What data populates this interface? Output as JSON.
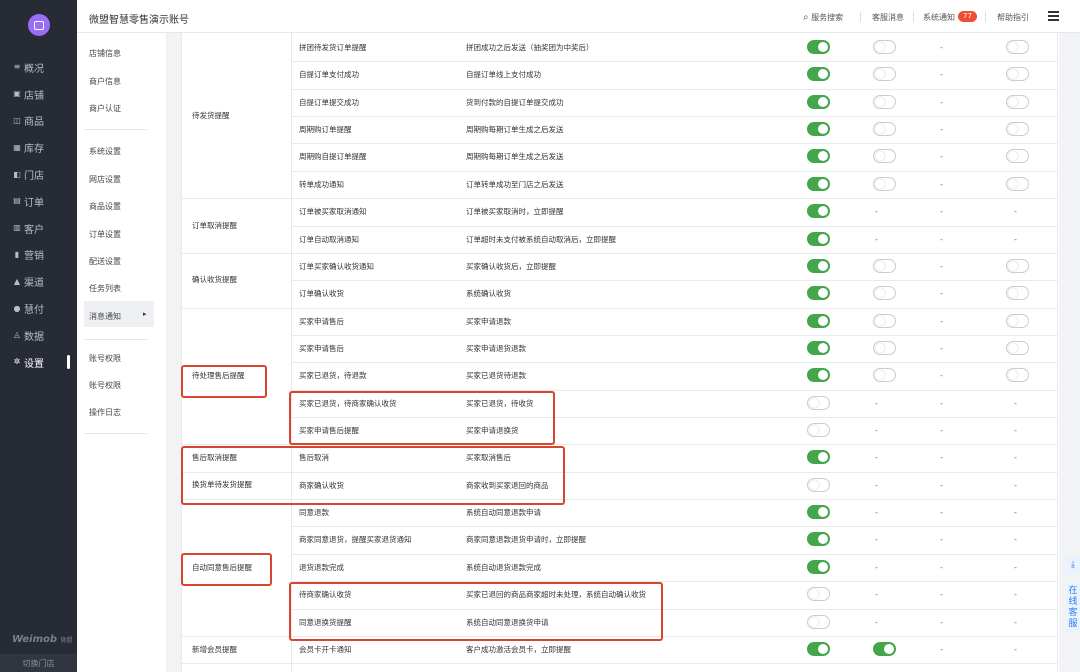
{
  "app": {
    "title": "微盟智慧零售演示账号",
    "brand": "Weimob",
    "brand_sub": "微盟",
    "switch_store": "切换门店",
    "accent": "#43a64a",
    "highlight": "#d9442c"
  },
  "header": {
    "search": "服务搜索",
    "service": "客服消息",
    "notify": "系统通知",
    "notify_count": "77",
    "help": "帮助指引"
  },
  "nav": [
    {
      "icon": "list-icon",
      "label": "概况"
    },
    {
      "icon": "store-icon",
      "label": "店铺"
    },
    {
      "icon": "bag-icon",
      "label": "商品"
    },
    {
      "icon": "grid-icon",
      "label": "库存"
    },
    {
      "icon": "door-icon",
      "label": "门店"
    },
    {
      "icon": "order-icon",
      "label": "订单"
    },
    {
      "icon": "user-icon",
      "label": "客户"
    },
    {
      "icon": "chart-icon",
      "label": "营销"
    },
    {
      "icon": "warning-icon",
      "label": "渠道"
    },
    {
      "icon": "pay-icon",
      "label": "慧付"
    },
    {
      "icon": "data-icon",
      "label": "数据"
    },
    {
      "icon": "gear-icon",
      "label": "设置"
    }
  ],
  "subnav": {
    "g1": [
      "店铺信息",
      "商户信息",
      "商户认证"
    ],
    "g2_title": "系统设置",
    "g2": [
      "网店设置",
      "商品设置",
      "订单设置",
      "配送设置",
      "任务列表",
      "消息通知"
    ],
    "g3_title": "账号权限",
    "g3": [
      "账号权限",
      "操作日志"
    ]
  },
  "groups": [
    "待发货提醒",
    "订单取消提醒",
    "确认收货提醒",
    "待处理售后提醒",
    "售后取消提醒",
    "换货单待发货提醒",
    "自动同意售后提醒",
    "新增会员提醒"
  ],
  "rows": [
    {
      "name": "拼团待发货订单提醒",
      "desc": "拼团成功之后发送（抽奖团为中奖后）",
      "c1": "on",
      "c2": "off",
      "c3": "-",
      "c4": "off"
    },
    {
      "name": "自提订单支付成功",
      "desc": "自提订单线上支付成功",
      "c1": "on",
      "c2": "off",
      "c3": "-",
      "c4": "off"
    },
    {
      "name": "自提订单提交成功",
      "desc": "货到付款的自提订单提交成功",
      "c1": "on",
      "c2": "off",
      "c3": "-",
      "c4": "off"
    },
    {
      "name": "周期购订单提醒",
      "desc": "周期购每期订单生成之后发送",
      "c1": "on",
      "c2": "off",
      "c3": "-",
      "c4": "off"
    },
    {
      "name": "周期购自提订单提醒",
      "desc": "周期购每期订单生成之后发送",
      "c1": "on",
      "c2": "off",
      "c3": "-",
      "c4": "off"
    },
    {
      "name": "转单成功通知",
      "desc": "订单转单成功至门店之后发送",
      "c1": "on",
      "c2": "off",
      "c3": "-",
      "c4": "off"
    },
    {
      "name": "订单被买家取消通知",
      "desc": "订单被买家取消时，立即提醒",
      "c1": "on",
      "c2": "-",
      "c3": "-",
      "c4": "-"
    },
    {
      "name": "订单自动取消通知",
      "desc": "订单超时未支付被系统自动取消后，立即提醒",
      "c1": "on",
      "c2": "-",
      "c3": "-",
      "c4": "-"
    },
    {
      "name": "订单买家确认收货通知",
      "desc": "买家确认收货后，立即提醒",
      "c1": "on",
      "c2": "off",
      "c3": "-",
      "c4": "off"
    },
    {
      "name": "订单确认收货",
      "desc": "系统确认收货",
      "c1": "on",
      "c2": "off",
      "c3": "-",
      "c4": "off"
    },
    {
      "name": "买家申请售后",
      "desc": "买家申请退款",
      "c1": "on",
      "c2": "off",
      "c3": "-",
      "c4": "off"
    },
    {
      "name": "买家申请售后",
      "desc": "买家申请退货退款",
      "c1": "on",
      "c2": "off",
      "c3": "-",
      "c4": "off"
    },
    {
      "name": "买家已退货，待退款",
      "desc": "买家已退货待退款",
      "c1": "on",
      "c2": "off",
      "c3": "-",
      "c4": "off"
    },
    {
      "name": "买家已退货，待商家确认收货",
      "desc": "买家已退货，待收货",
      "c1": "off",
      "c2": "-",
      "c3": "-",
      "c4": "-"
    },
    {
      "name": "买家申请售后提醒",
      "desc": "买家申请退换货",
      "c1": "off",
      "c2": "-",
      "c3": "-",
      "c4": "-"
    },
    {
      "name": "售后取消",
      "desc": "买家取消售后",
      "c1": "on",
      "c2": "-",
      "c3": "-",
      "c4": "-"
    },
    {
      "name": "商家确认收货",
      "desc": "商家收到买家退回的商品",
      "c1": "off",
      "c2": "-",
      "c3": "-",
      "c4": "-"
    },
    {
      "name": "同意退款",
      "desc": "系统自动同意退款申请",
      "c1": "on",
      "c2": "-",
      "c3": "-",
      "c4": "-"
    },
    {
      "name": "商家同意退货，提醒买家退货通知",
      "desc": "商家同意退款退货申请时，立即提醒",
      "c1": "on",
      "c2": "-",
      "c3": "-",
      "c4": "-"
    },
    {
      "name": "退货退款完成",
      "desc": "系统自动退货退款完成",
      "c1": "on",
      "c2": "-",
      "c3": "-",
      "c4": "-"
    },
    {
      "name": "待商家确认收货",
      "desc": "买家已退回的商品商家超时未处理，系统自动确认收货",
      "c1": "off",
      "c2": "-",
      "c3": "-",
      "c4": "-"
    },
    {
      "name": "同意退换货提醒",
      "desc": "系统自动同意退换货申请",
      "c1": "off",
      "c2": "-",
      "c3": "-",
      "c4": "-"
    },
    {
      "name": "会员卡开卡通知",
      "desc": "客户成功激活会员卡，立即提醒",
      "c1": "on",
      "c2": "on",
      "c3": "-",
      "c4": "-"
    }
  ],
  "float": {
    "top": "⤓",
    "service": "在线客服"
  }
}
